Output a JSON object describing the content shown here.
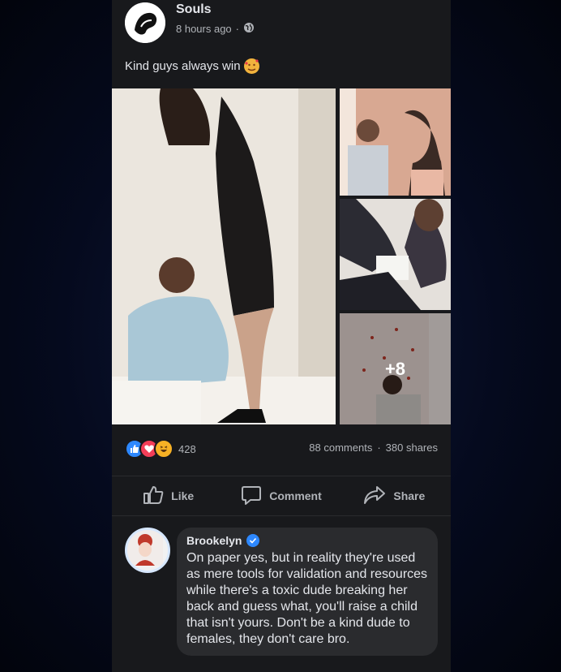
{
  "post": {
    "page_name": "Souls",
    "timestamp": "8 hours ago",
    "separator": "·",
    "audience_icon": "globe-icon",
    "caption": "Kind guys always win",
    "caption_emoji": "smiling-face-with-hearts-emoji",
    "photos": {
      "more_count": "+8"
    }
  },
  "stats": {
    "reaction_icons": [
      "like-icon",
      "love-icon",
      "haha-icon"
    ],
    "reaction_count": "428",
    "comments": "88 comments",
    "dot": "·",
    "shares": "380 shares"
  },
  "actions": {
    "like": "Like",
    "comment": "Comment",
    "share": "Share"
  },
  "comment": {
    "author": "Brookelyn",
    "verified_icon": "verified-badge-icon",
    "text": "On paper yes, but in reality they're used as mere tools for validation and resources while there's a toxic dude breaking her back and guess what, you'll raise a child that isn't yours. Don't be a kind dude to females, they don't care bro."
  },
  "colors": {
    "card_bg": "#18191c",
    "accent_blue": "#2d88ff",
    "text_primary": "#e4e6eb",
    "text_secondary": "#b0b3b8"
  }
}
